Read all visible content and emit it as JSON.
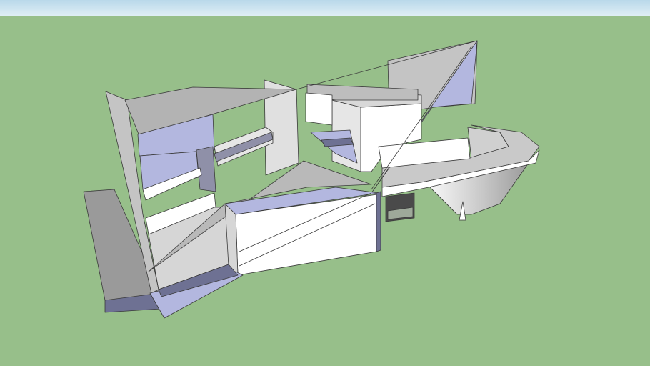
{
  "viewport": {
    "sky_top": "#b9d8ea",
    "sky_bottom": "#dfeef5",
    "ground": "#97bf8a"
  },
  "model_colors": {
    "light_face": "#ffffff",
    "mid_face": "#d6d6d6",
    "shade_face": "#b5b5b5",
    "dark_face": "#8f8f8f",
    "blue_face": "#b3b7df",
    "dark_blue_face": "#6e7193",
    "edge": "#3a3a3a"
  }
}
